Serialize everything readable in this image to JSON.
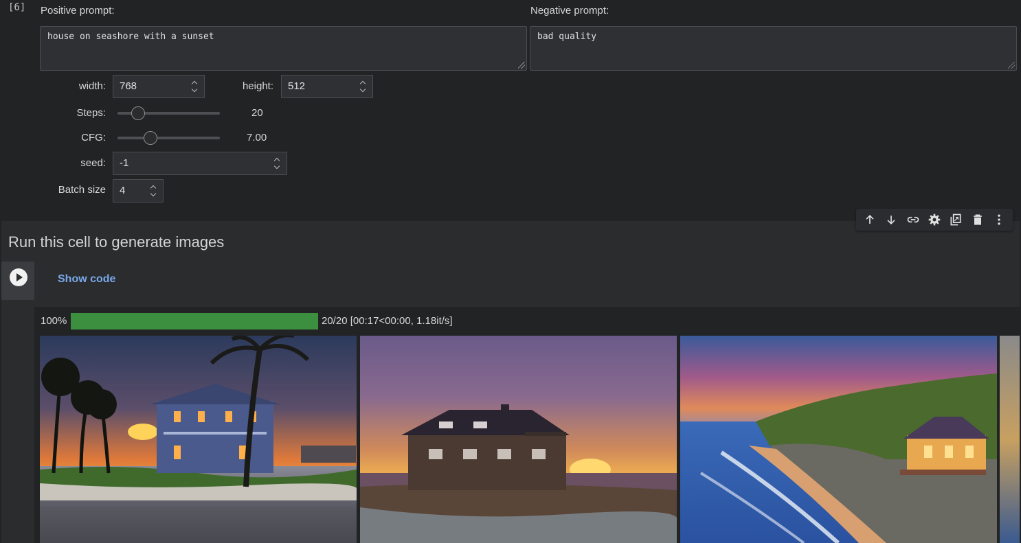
{
  "cell_number": "[6]",
  "form": {
    "positive_label": "Positive prompt:",
    "positive_value": "house on seashore with a sunset",
    "negative_label": "Negative prompt:",
    "negative_value": "bad quality",
    "width_label": "width:",
    "width_value": "768",
    "height_label": "height:",
    "height_value": "512",
    "steps_label": "Steps:",
    "steps_value": "20",
    "steps_fraction": 0.2,
    "cfg_label": "CFG:",
    "cfg_value": "7.00",
    "cfg_fraction": 0.32,
    "seed_label": "seed:",
    "seed_value": "-1",
    "batch_label": "Batch size",
    "batch_value": "4"
  },
  "toolbar": {
    "icons": [
      "arrow-up-icon",
      "arrow-down-icon",
      "link-icon",
      "gear-icon",
      "mirror-cell-icon",
      "trash-icon",
      "more-vert-icon"
    ]
  },
  "run_cell": {
    "title": "Run this cell to generate images",
    "show_code": "Show code"
  },
  "progress": {
    "percent_label": "100%",
    "fraction": 1.0,
    "status": "20/20 [00:17<00:00, 1.18it/s]",
    "fill_color": "#3c8f3f"
  },
  "images": [
    {
      "scene": "blue-house-palms-sunset"
    },
    {
      "scene": "dark-house-painted-sunset"
    },
    {
      "scene": "coastal-cliff-house"
    },
    {
      "scene": "partial-fourth-image"
    }
  ]
}
